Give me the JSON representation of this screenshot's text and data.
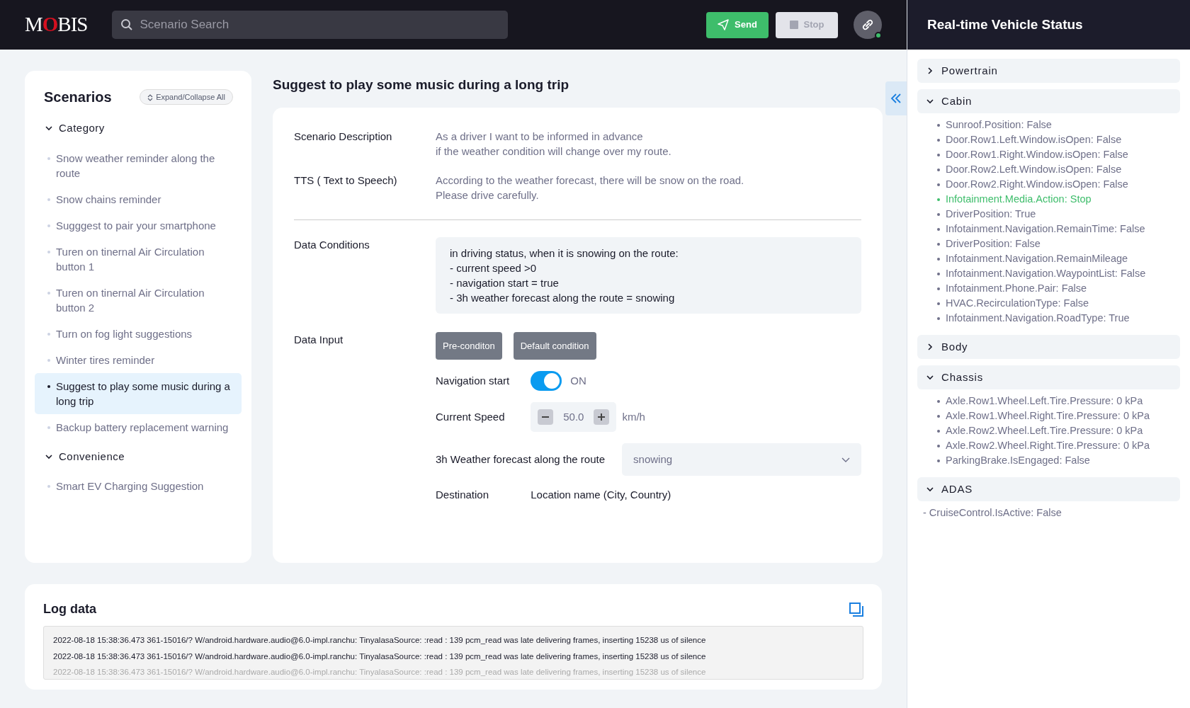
{
  "header": {
    "logo": "MOBIS",
    "search": {
      "placeholder": "Scenario Search"
    },
    "buttons": [
      {
        "label": "Send",
        "kind": "send",
        "disabled": false
      },
      {
        "label": "Stop",
        "kind": "stop",
        "disabled": true
      }
    ],
    "connected": true
  },
  "sidebar": {
    "title": "Scenarios",
    "expand_all": "Expand/Collapse All",
    "groups": [
      {
        "label": "Category",
        "expanded": true,
        "children": [
          {
            "label": "Snow weather reminder along the route",
            "selected": false
          },
          {
            "label": "Snow chains reminder",
            "selected": false
          },
          {
            "label": "Sugggest to pair your smartphone",
            "selected": false
          },
          {
            "label": "Turen on tinernal Air Circulation button 1",
            "selected": false
          },
          {
            "label": "Turen on tinernal Air Circulation button 2",
            "selected": false
          },
          {
            "label": "Turn on fog light suggestions",
            "selected": false
          },
          {
            "label": "Winter tires reminder",
            "selected": false
          },
          {
            "label": "Suggest to play some music during a long trip",
            "selected": true
          },
          {
            "label": "Backup battery replacement warning",
            "selected": false
          }
        ]
      },
      {
        "label": "Convenience",
        "expanded": true,
        "children": [
          {
            "label": "Smart EV Charging Suggestion",
            "selected": false
          }
        ]
      }
    ]
  },
  "scenario": {
    "title": "Suggest to play some music during a long trip",
    "fields": [
      {
        "label": "Scenario Description",
        "lines": [
          "As a driver I want to be informed in advance",
          "if the weather condition will change over my route."
        ]
      },
      {
        "label": "TTS ( Text to Speech)",
        "lines": [
          "According to the weather forecast, there will be snow on the road.",
          "Please drive carefully."
        ]
      }
    ],
    "conditions": {
      "label": "Data Conditions",
      "lines": [
        "in driving status, when it is snowing on the route:",
        "- current speed >0",
        "- navigation start = true",
        "- 3h weather forecast along the route = snowing"
      ]
    },
    "data_input": {
      "label": "Data Input",
      "buttons": [
        "Pre-conditon",
        "Default condition"
      ],
      "navigation": {
        "label": "Navigation start",
        "on": true,
        "state_text": "ON"
      },
      "speed": {
        "label": "Current Speed",
        "value": "50.0",
        "unit": "km/h"
      },
      "weather": {
        "label": "3h Weather forecast along the route",
        "value": "snowing"
      },
      "destination": {
        "label": "Destination",
        "value": "Location name (City, Country)"
      }
    }
  },
  "log": {
    "title": "Log data",
    "lines": [
      "2022-08-18 15:38:36.473 361-15016/?  W/android.hardware.audio@6.0-impl.ranchu:  TinyalasaSource: :read : 139  pcm_read  was  late  delivering  frames, inserting 15238 us of silence",
      "2022-08-18 15:38:36.473 361-15016/?  W/android.hardware.audio@6.0-impl.ranchu:  TinyalasaSource: :read : 139  pcm_read  was  late  delivering  frames, inserting 15238 us of silence",
      "2022-08-18 15:38:36.473 361-15016/?  W/android.hardware.audio@6.0-impl.ranchu:  TinyalasaSource: :read : 139  pcm_read  was  late  delivering  frames, inserting 15238 us of silence"
    ]
  },
  "status_panel": {
    "title": "Real-time Vehicle Status",
    "sections": [
      {
        "label": "Powertrain",
        "expanded": false
      },
      {
        "label": "Cabin",
        "expanded": true,
        "items": [
          {
            "text": "Sunroof.Position: False",
            "active": false,
            "bullet": true
          },
          {
            "text": "Door.Row1.Left.Window.isOpen: False",
            "active": false,
            "bullet": true
          },
          {
            "text": "Door.Row1.Right.Window.isOpen: False",
            "active": false,
            "bullet": true
          },
          {
            "text": "Door.Row2.Left.Window.isOpen: False",
            "active": false,
            "bullet": true
          },
          {
            "text": "Door.Row2.Right.Window.isOpen: False",
            "active": false,
            "bullet": true
          },
          {
            "text": "Infotainment.Media.Action: Stop",
            "active": true,
            "bullet": true
          },
          {
            "text": "DriverPosition: True",
            "active": false,
            "bullet": true
          },
          {
            "text": "Infotainment.Navigation.RemainTime: False",
            "active": false,
            "bullet": true
          },
          {
            "text": "DriverPosition: False",
            "active": false,
            "bullet": true
          },
          {
            "text": "Infotainment.Navigation.RemainMileage",
            "active": false,
            "bullet": true
          },
          {
            "text": "Infotainment.Navigation.WaypointList: False",
            "active": false,
            "bullet": true
          },
          {
            "text": "Infotainment.Phone.Pair: False",
            "active": false,
            "bullet": true
          },
          {
            "text": "HVAC.RecirculationType: False",
            "active": false,
            "bullet": true
          },
          {
            "text": "Infotainment.Navigation.RoadType: True",
            "active": false,
            "bullet": true
          }
        ]
      },
      {
        "label": "Body",
        "expanded": false
      },
      {
        "label": "Chassis",
        "expanded": true,
        "items": [
          {
            "text": "Axle.Row1.Wheel.Left.Tire.Pressure: 0 kPa",
            "active": false,
            "bullet": true
          },
          {
            "text": "Axle.Row1.Wheel.Right.Tire.Pressure: 0 kPa",
            "active": false,
            "bullet": true
          },
          {
            "text": "Axle.Row2.Wheel.Left.Tire.Pressure: 0 kPa",
            "active": false,
            "bullet": true
          },
          {
            "text": "Axle.Row2.Wheel.Right.Tire.Pressure: 0 kPa",
            "active": false,
            "bullet": true
          },
          {
            "text": "ParkingBrake.IsEngaged: False",
            "active": false,
            "bullet": true
          }
        ]
      },
      {
        "label": "ADAS",
        "expanded": true,
        "items": [
          {
            "text": "- CruiseControl.IsActive: False",
            "active": false,
            "bullet": false
          }
        ]
      }
    ]
  }
}
